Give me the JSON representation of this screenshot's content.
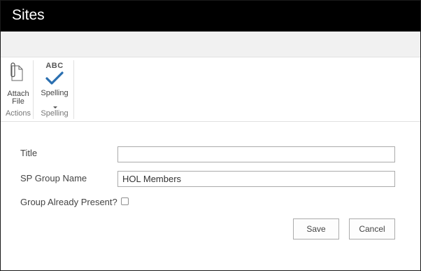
{
  "header": {
    "title": "Sites"
  },
  "ribbon": {
    "groups": [
      {
        "label": "Actions",
        "buttons": [
          {
            "label_line1": "Attach",
            "label_line2": "File",
            "icon": "paperclip-document-icon"
          }
        ]
      },
      {
        "label": "Spelling",
        "buttons": [
          {
            "icon_text": "ABC",
            "label": "Spelling",
            "icon": "spell-check-icon"
          }
        ]
      }
    ]
  },
  "form": {
    "fields": [
      {
        "label": "Title",
        "value": ""
      },
      {
        "label": "SP Group Name",
        "value": "HOL Members"
      },
      {
        "label": "Group Already Present?",
        "checked": false
      }
    ],
    "save_label": "Save",
    "cancel_label": "Cancel"
  },
  "colors": {
    "titlebar": "#000000",
    "checkmark": "#2a6fb0"
  }
}
